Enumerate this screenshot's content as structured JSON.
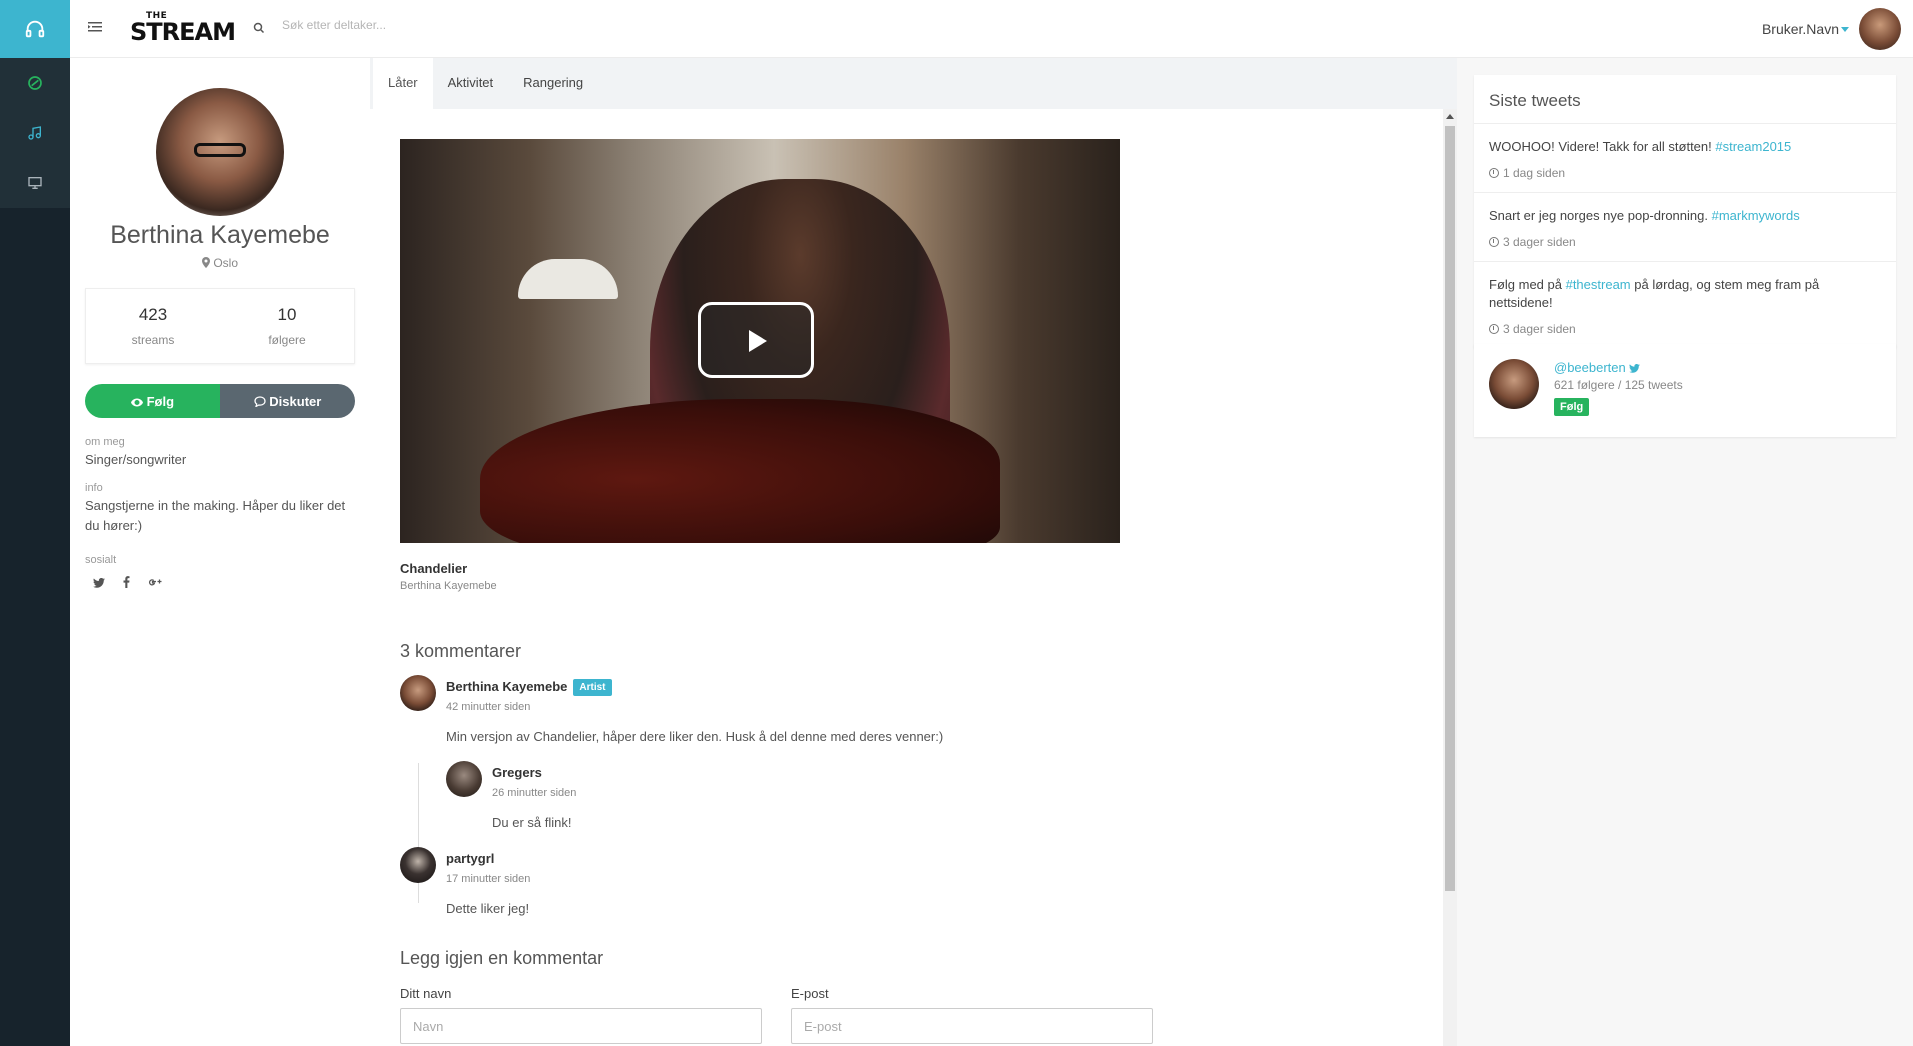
{
  "app": {
    "logo_small": "THE",
    "logo_main": "STREAM"
  },
  "search": {
    "placeholder": "Søk etter deltaker..."
  },
  "user": {
    "name": "Bruker.Navn"
  },
  "rail": {
    "icons": [
      "headphones-icon",
      "disc-icon",
      "music-note-icon",
      "monitor-icon"
    ]
  },
  "profile": {
    "name": "Berthina Kayemebe",
    "location": "Oslo",
    "streams_value": "423",
    "streams_label": "streams",
    "followers_value": "10",
    "followers_label": "følgere",
    "follow_label": "Følg",
    "discuss_label": "Diskuter",
    "about_label": "om meg",
    "about_value": "Singer/songwriter",
    "info_label": "info",
    "info_value": "Sangstjerne in the making. Håper du liker det du hører:)",
    "social_label": "sosialt",
    "social_icons": [
      "twitter-icon",
      "facebook-icon",
      "google-plus-icon"
    ]
  },
  "tabs": [
    "Låter",
    "Aktivitet",
    "Rangering"
  ],
  "song": {
    "title": "Chandelier",
    "artist": "Berthina Kayemebe"
  },
  "comments": {
    "heading": "3 kommentarer",
    "items": [
      {
        "name": "Berthina Kayemebe",
        "badge": "Artist",
        "time": "42 minutter siden",
        "text": "Min versjon av Chandelier, håper dere liker den. Husk å del denne med deres venner:)"
      },
      {
        "name": "Gregers",
        "time": "26 minutter siden",
        "text": "Du er så flink!"
      },
      {
        "name": "partygrl",
        "time": "17 minutter siden",
        "text": "Dette liker jeg!"
      }
    ]
  },
  "reply": {
    "heading": "Legg igjen en kommentar",
    "name_label": "Ditt navn",
    "name_placeholder": "Navn",
    "email_label": "E-post",
    "email_placeholder": "E-post"
  },
  "tweets": {
    "title": "Siste tweets",
    "items": [
      {
        "text": "WOOHOO! Videre! Takk for all støtten! ",
        "tag": "#stream2015",
        "after": "",
        "time": "1 dag siden"
      },
      {
        "text": "Snart er jeg norges nye pop-dronning. ",
        "tag": "#markmywords",
        "after": "",
        "time": "3 dager siden"
      },
      {
        "text": "Følg med på ",
        "tag": "#thestream",
        "after": " på lørdag, og stem meg fram på nettsidene!",
        "time": "3 dager siden"
      }
    ]
  },
  "twitter_card": {
    "handle": "@beeberten",
    "stats": "621 følgere / 125 tweets",
    "follow_label": "Følg"
  },
  "colors": {
    "accent": "#3db5cf",
    "follow_green": "#27b35e",
    "rail_bg": "#17232c",
    "discuss_gray": "#5a6770"
  }
}
